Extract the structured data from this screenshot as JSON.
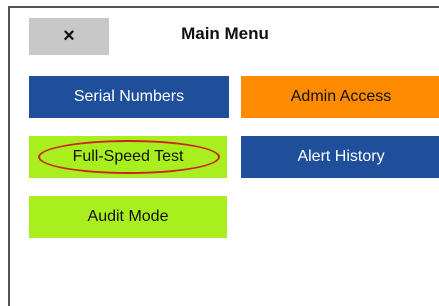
{
  "header": {
    "close_label": "×",
    "title": "Main Menu"
  },
  "menu": {
    "serial_numbers": "Serial Numbers",
    "admin_access": "Admin Access",
    "full_speed_test": "Full-Speed Test",
    "alert_history": "Alert History",
    "audit_mode": "Audit Mode"
  },
  "colors": {
    "blue": "#1f4e9a",
    "orange": "#ff8c00",
    "lime": "#a9ef1e",
    "close_bg": "#c8c8c8",
    "highlight": "#cc2222"
  },
  "icons": {
    "close": "close-icon"
  }
}
